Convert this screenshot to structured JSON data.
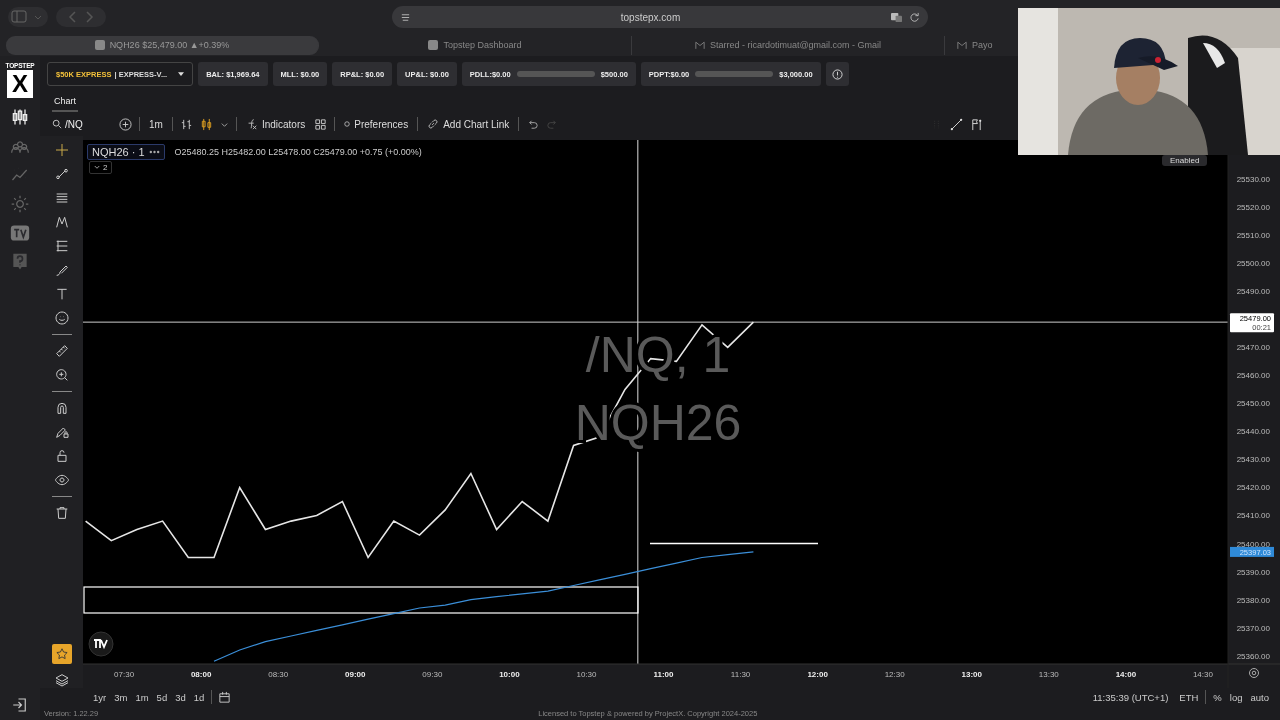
{
  "browser": {
    "url": "topstepx.com",
    "tabs": [
      {
        "label": "NQH26 $25,479.00 ▲+0.39%",
        "selected": true
      },
      {
        "label": "Topstep Dashboard",
        "selected": false
      },
      {
        "label": "Starred - ricardotimuat@gmail.com - Gmail",
        "selected": false
      },
      {
        "label": "Payo",
        "selected": false
      }
    ]
  },
  "logo": {
    "top": "TOPSTEP",
    "mark": "X"
  },
  "account": {
    "badge": "$50K EXPRESS",
    "name": "| EXPRESS-V..."
  },
  "stats": [
    {
      "kind": "value",
      "label": "BAL: $1,969.64"
    },
    {
      "kind": "value",
      "label": "MLL: $0.00"
    },
    {
      "kind": "value",
      "label": "RP&L: $0.00"
    },
    {
      "kind": "value",
      "label": "UP&L: $0.00"
    },
    {
      "kind": "gauge",
      "label": "PDLL:$0.00",
      "limit": "$500.00",
      "level": 0
    },
    {
      "kind": "gauge",
      "label": "PDPT:$0.00",
      "limit": "$3,000.00",
      "level": 0
    }
  ],
  "panel_tabs": [
    {
      "label": "Chart",
      "selected": true
    }
  ],
  "toolbar": {
    "symbol": "/NQ",
    "interval": "1m",
    "indicators": "Indicators",
    "preferences": "Preferences",
    "chart_link": "Add Chart Link"
  },
  "legend": {
    "symbol": "NQH26 · 1",
    "ohlc": "O25480.25 H25482.00 L25478.00 C25479.00 +0.75 (+0.00%)",
    "collapsed_count": "2"
  },
  "watermark": {
    "line1": "/NQ, 1",
    "line2": "NQH26"
  },
  "chart_data": {
    "type": "line",
    "x": [
      435,
      445,
      455,
      465,
      475,
      485,
      495,
      505,
      515,
      525,
      535,
      545,
      555,
      565,
      575,
      585,
      595,
      605,
      615,
      625,
      635,
      645,
      655,
      665,
      675,
      685,
      695
    ],
    "series": [
      {
        "color": "#e6e6e6",
        "values": [
          25408,
          25401,
          25405,
          25408,
          25395,
          25395,
          25420,
          25405,
          25408,
          25410,
          25415,
          25395,
          25408,
          25403,
          25412,
          25425,
          25405,
          25415,
          25408,
          25435,
          25438,
          25455,
          25466,
          25465,
          25478,
          25470,
          25479
        ]
      },
      {
        "color": "#3b8fd9",
        "values": [
          null,
          null,
          null,
          null,
          null,
          25358,
          25362,
          25365,
          25367,
          25369,
          25371,
          25373,
          25375,
          25377,
          25378,
          25380,
          25381,
          25382,
          25383,
          25385,
          25387,
          25389,
          25391,
          25393,
          25395,
          25396,
          25397
        ]
      }
    ],
    "xlim": [
      434,
      900
    ],
    "ylim": [
      25357,
      25544
    ],
    "xticks": [
      {
        "value": 450,
        "label": "07:30"
      },
      {
        "value": 480,
        "label": "08:00"
      },
      {
        "value": 510,
        "label": "08:30"
      },
      {
        "value": 540,
        "label": "09:00"
      },
      {
        "value": 570,
        "label": "09:30"
      },
      {
        "value": 600,
        "label": "10:00"
      },
      {
        "value": 630,
        "label": "10:30"
      },
      {
        "value": 660,
        "label": "11:00"
      },
      {
        "value": 690,
        "label": "11:30"
      },
      {
        "value": 720,
        "label": "12:00"
      },
      {
        "value": 750,
        "label": "12:30"
      },
      {
        "value": 780,
        "label": "13:00"
      },
      {
        "value": 810,
        "label": "13:30"
      },
      {
        "value": 840,
        "label": "14:00"
      },
      {
        "value": 870,
        "label": "14:30"
      }
    ],
    "yticks": [
      {
        "value": 25360,
        "label": "25360.00"
      },
      {
        "value": 25370,
        "label": "25370.00"
      },
      {
        "value": 25380,
        "label": "25380.00"
      },
      {
        "value": 25390,
        "label": "25390.00"
      },
      {
        "value": 25400,
        "label": "25400.00"
      },
      {
        "value": 25410,
        "label": "25410.00"
      },
      {
        "value": 25420,
        "label": "25420.00"
      },
      {
        "value": 25430,
        "label": "25430.00"
      },
      {
        "value": 25440,
        "label": "25440.00"
      },
      {
        "value": 25450,
        "label": "25450.00"
      },
      {
        "value": 25460,
        "label": "25460.00"
      },
      {
        "value": 25470,
        "label": "25470.00"
      },
      {
        "value": 25490,
        "label": "25490.00"
      },
      {
        "value": 25500,
        "label": "25500.00"
      },
      {
        "value": 25510,
        "label": "25510.00"
      },
      {
        "value": 25520,
        "label": "25520.00"
      },
      {
        "value": 25530,
        "label": "25530.00"
      }
    ],
    "ref_lines": [
      {
        "axis": "x",
        "value": 650
      },
      {
        "axis": "y",
        "value": 25479
      },
      {
        "axis": "y",
        "value": 25400
      }
    ]
  },
  "price_labels": {
    "last": "25479.00",
    "countdown": "00:21",
    "vwap": "25397.03"
  },
  "ranges": [
    "1yr",
    "3m",
    "1m",
    "5d",
    "3d",
    "1d"
  ],
  "status": {
    "clock": "11:35:39 (UTC+1)",
    "session": "ETH",
    "percent": "%",
    "log": "log",
    "auto": "auto"
  },
  "footer": {
    "version": "Version: 1.22.29",
    "license": "Licensed to Topstep & powered by ProjectX. Copyright 2024-2025"
  },
  "webcam": {
    "kind": "picture",
    "tooltip": "Enabled"
  }
}
